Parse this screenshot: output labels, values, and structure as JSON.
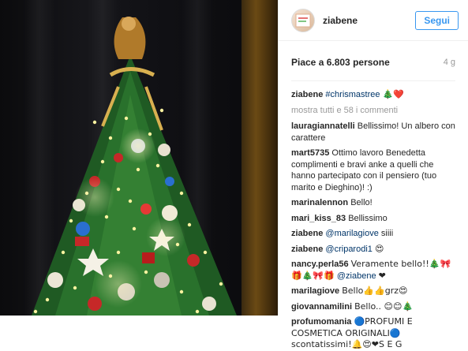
{
  "header": {
    "username": "ziabene",
    "follow_label": "Segui"
  },
  "post": {
    "likes": "Piace a 6.803 persone",
    "time": "4 g",
    "caption_user": "ziabene",
    "caption_tag": "#chrismastree",
    "caption_emoji": "🎄❤️",
    "more_comments": "mostra tutti e 58 i commenti"
  },
  "comments": [
    {
      "user": "lauragiannatelli",
      "text": "Bellissimo! Un albero con carattere"
    },
    {
      "user": "mart5735",
      "text": "Ottimo lavoro Benedetta complimenti e bravi anke a quelli che hanno partecipato con il pensiero (tuo marito e Dieghino)! :)"
    },
    {
      "user": "marinalennon",
      "text": "Bello!"
    },
    {
      "user": "mari_kiss_83",
      "text": "Bellissimo"
    },
    {
      "user": "ziabene",
      "mention": "@marilagiove",
      "text": "siiii"
    },
    {
      "user": "ziabene",
      "mention": "@criparodi1",
      "text": "😍"
    },
    {
      "user": "nancy.perla56",
      "text": "Veramente bello!!🎄🎀🎁🎄🎀🎁",
      "mention": "@ziabene",
      "tail": "❤"
    },
    {
      "user": "marilagiove",
      "text": "Bello👍👍grz😍"
    },
    {
      "user": "giovannamilini",
      "text": "Bello.. 😊😊🎄"
    },
    {
      "user": "profumomania",
      "text": "🔵PROFUMI E COSMETICA ORIGINALI🔵 scontatissimi!🔔😍❤S E G"
    }
  ],
  "colors": {
    "accent": "#3897f0",
    "mention": "#003569",
    "muted": "#999999"
  }
}
